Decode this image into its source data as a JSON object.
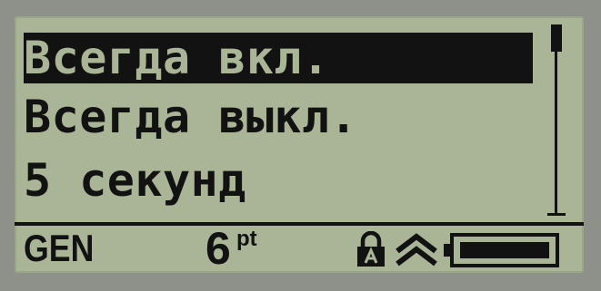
{
  "menu": {
    "items": [
      {
        "label": "Всегда вкл.",
        "selected": true
      },
      {
        "label": "Всегда выкл.",
        "selected": false
      },
      {
        "label": "5 секунд",
        "selected": false
      }
    ]
  },
  "status_bar": {
    "font_name": "GEN",
    "font_size": "6",
    "font_unit": "pt",
    "icons": [
      "lock-icon",
      "caps-lock-icon",
      "battery-icon"
    ]
  },
  "colors": {
    "lcd_background": "#a9b596",
    "lcd_foreground": "#121212",
    "bezel": "#8e918a"
  }
}
